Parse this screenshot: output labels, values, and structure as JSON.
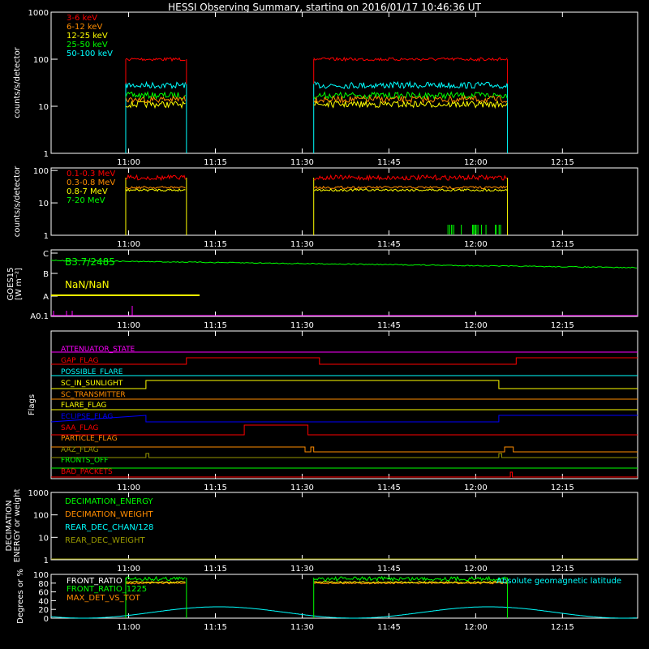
{
  "title": "HESSI Observing Summary, starting on 2016/01/17 10:46:36 UT",
  "time_ticks": [
    "11:00",
    "11:15",
    "11:30",
    "11:45",
    "12:00",
    "12:15"
  ],
  "colors": {
    "red": "#ff0000",
    "orange": "#ff8c00",
    "yellow": "#ffff00",
    "green": "#00ff00",
    "cyan": "#00ffff",
    "magenta": "#ff00ff",
    "blue": "#0000ff",
    "olive": "#999900",
    "white": "#ffffff"
  },
  "chart_data": [
    {
      "type": "line",
      "ylabel": "counts/s/detector",
      "yscale": "log",
      "ylim": [
        1,
        1000
      ],
      "ytick_labels": [
        "1",
        "10",
        "100",
        "1000"
      ],
      "xlim": [
        "10:46:36",
        "12:28:00"
      ],
      "observing_intervals": [
        [
          "10:59:30",
          "11:10:00"
        ],
        [
          "11:32:00",
          "12:05:30"
        ]
      ],
      "series": [
        {
          "name": "3-6 keV",
          "color": "red",
          "level": 100
        },
        {
          "name": "6-12 keV",
          "color": "orange",
          "level": 14
        },
        {
          "name": "12-25 keV",
          "color": "yellow",
          "level": 11
        },
        {
          "name": "25-50 keV",
          "color": "green",
          "level": 17
        },
        {
          "name": "50-100 keV",
          "color": "cyan",
          "level": 28
        }
      ]
    },
    {
      "type": "line",
      "ylabel": "counts/s/detector",
      "yscale": "log",
      "ylim": [
        1,
        120
      ],
      "ytick_labels": [
        "1",
        "10",
        "100"
      ],
      "observing_intervals": [
        [
          "10:59:30",
          "11:10:00"
        ],
        [
          "11:32:00",
          "12:05:30"
        ]
      ],
      "series": [
        {
          "name": "0.1-0.3 MeV",
          "color": "red",
          "level": 60
        },
        {
          "name": "0.3-0.8 MeV",
          "color": "orange",
          "level": 30
        },
        {
          "name": "0.8-7 MeV",
          "color": "yellow",
          "level": 25
        },
        {
          "name": "7-20 MeV",
          "color": "green",
          "level": 1
        }
      ]
    },
    {
      "type": "line",
      "ylabel": "GOES15",
      "ylabel2": "[W m⁻²]",
      "ytick_labels": [
        "A0.1",
        "A",
        "B",
        "C"
      ],
      "annotations": [
        {
          "text": "B3.7/2485",
          "color": "green"
        },
        {
          "text": "NaN/NaN",
          "color": "yellow"
        }
      ]
    },
    {
      "type": "line",
      "ylabel": "Flags",
      "series": [
        {
          "name": "ATTENUATOR_STATE",
          "color": "magenta"
        },
        {
          "name": "GAP_FLAG",
          "color": "red"
        },
        {
          "name": "POSSIBLE_FLARE",
          "color": "cyan"
        },
        {
          "name": "SC_IN_SUNLIGHT",
          "color": "yellow"
        },
        {
          "name": "SC_TRANSMITTER",
          "color": "orange"
        },
        {
          "name": "FLARE_FLAG",
          "color": "yellow"
        },
        {
          "name": "ECLIPSE_FLAG",
          "color": "blue"
        },
        {
          "name": "SAA_FLAG",
          "color": "red"
        },
        {
          "name": "PARTICLE_FLAG",
          "color": "orange"
        },
        {
          "name": "AAZ_FLAG",
          "color": "olive"
        },
        {
          "name": "FRONTS_OFF",
          "color": "green"
        },
        {
          "name": "BAD_PACKETS",
          "color": "red"
        }
      ]
    },
    {
      "type": "line",
      "ylabel": "DECIMATION",
      "ylabel2": "ENERGY or weight",
      "yscale": "log",
      "ylim": [
        1,
        1000
      ],
      "ytick_labels": [
        "1",
        "10",
        "100",
        "1000"
      ],
      "series": [
        {
          "name": "DECIMATION_ENERGY",
          "color": "green"
        },
        {
          "name": "DECIMATION_WEIGHT",
          "color": "orange"
        },
        {
          "name": "REAR_DEC_CHAN/128",
          "color": "cyan"
        },
        {
          "name": "REAR_DEC_WEIGHT",
          "color": "olive"
        }
      ]
    },
    {
      "type": "line",
      "ylabel": "Degrees or %",
      "ylim": [
        0,
        100
      ],
      "ytick_labels": [
        "0",
        "20",
        "40",
        "60",
        "80",
        "100"
      ],
      "series": [
        {
          "name": "FRONT_RATIO",
          "color": "white"
        },
        {
          "name": "FRONT_RATIO_1225",
          "color": "green"
        },
        {
          "name": "MAX_DET_VS_TOT",
          "color": "orange"
        },
        {
          "name": "Absolute geomagnetic latitude",
          "color": "cyan"
        }
      ]
    }
  ]
}
